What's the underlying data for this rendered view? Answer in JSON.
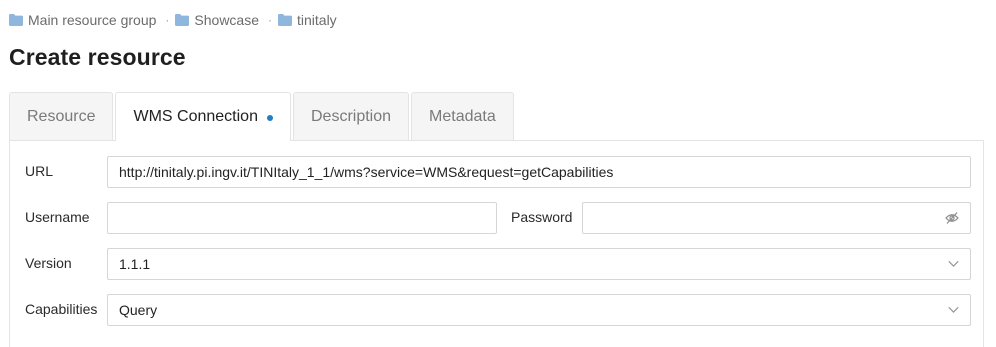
{
  "breadcrumb": {
    "items": [
      {
        "label": "Main resource group",
        "icon": "folder-icon"
      },
      {
        "label": "Showcase",
        "icon": "folder-icon"
      },
      {
        "label": "tinitaly",
        "icon": "folder-icon"
      }
    ],
    "separator": "·"
  },
  "page_title": "Create resource",
  "tabs": [
    {
      "label": "Resource",
      "active": false
    },
    {
      "label": "WMS Connection",
      "active": true,
      "modified_dot": true
    },
    {
      "label": "Description",
      "active": false
    },
    {
      "label": "Metadata",
      "active": false
    }
  ],
  "form": {
    "url": {
      "label": "URL",
      "value": "http://tinitaly.pi.ingv.it/TINItaly_1_1/wms?service=WMS&request=getCapabilities"
    },
    "username": {
      "label": "Username",
      "value": ""
    },
    "password": {
      "label": "Password",
      "value": "",
      "icon": "eye-invisible-icon"
    },
    "version": {
      "label": "Version",
      "value": "1.1.1",
      "icon": "chevron-down-icon"
    },
    "capabilities": {
      "label": "Capabilities",
      "value": "Query",
      "icon": "chevron-down-icon"
    }
  },
  "colors": {
    "folder": "#8fb7de",
    "accent": "#1f7fc0",
    "border": "#d6d6d6",
    "tab_bg": "#f5f5f5"
  }
}
